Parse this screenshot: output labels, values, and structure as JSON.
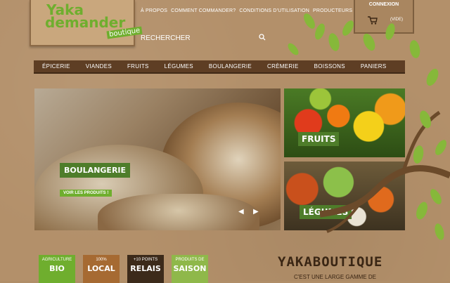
{
  "logo": {
    "line1": "Yaka",
    "line2": "demander",
    "line3": "boutique"
  },
  "top_links": [
    "À PROPOS",
    "COMMENT COMMANDER?",
    "CONDITIONS D'UTILISATION",
    "PRODUCTEURS"
  ],
  "search": {
    "placeholder": "RECHERCHER"
  },
  "account": {
    "login": "CONNEXION",
    "cart_count": "(VIDE)"
  },
  "menu": [
    "ÉPICERIE",
    "VIANDES",
    "FRUITS",
    "LÉGUMES",
    "BOULANGERIE",
    "CRÈMERIE",
    "BOISSONS",
    "PANIERS"
  ],
  "slider": {
    "title": "BOULANGERIE",
    "cta": "VOIR LES PRODUITS !"
  },
  "tiles": {
    "fruits": "FRUITS",
    "legumes": "LÉGUMES"
  },
  "badges": [
    {
      "small": "AGRICULTURE",
      "big": "BIO"
    },
    {
      "small": "100%",
      "big": "LOCAL"
    },
    {
      "small": "+10 POINTS",
      "big": "RELAIS"
    },
    {
      "small": "PRODUITS DE",
      "big": "SAISON"
    }
  ],
  "about": {
    "title": "YAKABOUTIQUE",
    "tagline": "C'EST UNE LARGE GAMME DE"
  },
  "colors": {
    "accent_green": "#6fae2e",
    "menu_brown": "#5e3e24",
    "paper": "#b3906a"
  }
}
